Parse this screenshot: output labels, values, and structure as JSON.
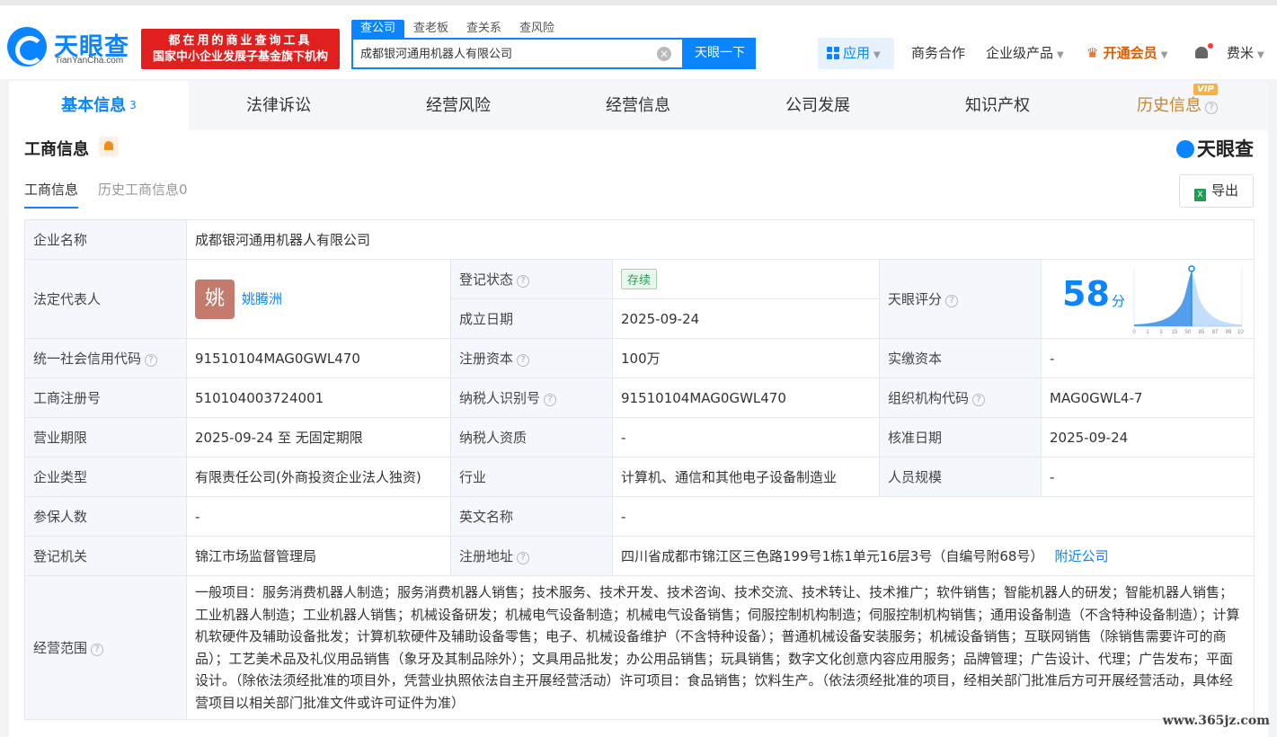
{
  "header": {
    "logo_text": "天眼查",
    "logo_domain": "TianYanCha.com",
    "promo_line1": "都在用的商业查询工具",
    "promo_line2": "国家中小企业发展子基金旗下机构",
    "search_tabs": [
      "查公司",
      "查老板",
      "查关系",
      "查风险"
    ],
    "search_value": "成都银河通用机器人有限公司",
    "search_button": "天眼一下",
    "nav": {
      "app": "应用",
      "business": "商务合作",
      "enterprise": "企业级产品",
      "vip": "开通会员",
      "user": "费米"
    }
  },
  "tabs": {
    "basic": "基本信息",
    "basic_count": "3",
    "legal": "法律诉讼",
    "risk": "经营风险",
    "operation": "经营信息",
    "development": "公司发展",
    "ip": "知识产权",
    "history": "历史信息",
    "vip_badge": "VIP"
  },
  "section": {
    "title": "工商信息",
    "brand": "天眼查",
    "subtab_current": "工商信息",
    "subtab_history": "历史工商信息0",
    "export": "导出"
  },
  "info": {
    "company_name_label": "企业名称",
    "company_name": "成都银河通用机器人有限公司",
    "legal_rep_label": "法定代表人",
    "legal_rep_avatar": "姚",
    "legal_rep": "姚腾洲",
    "reg_status_label": "登记状态",
    "reg_status": "存续",
    "found_date_label": "成立日期",
    "found_date": "2025-09-24",
    "score_label": "天眼评分",
    "score": "58",
    "score_unit": "分",
    "credit_code_label": "统一社会信用代码",
    "credit_code": "91510104MAG0GWL470",
    "reg_capital_label": "注册资本",
    "reg_capital": "100万",
    "paid_capital_label": "实缴资本",
    "paid_capital": "-",
    "reg_no_label": "工商注册号",
    "reg_no": "510104003724001",
    "tax_id_label": "纳税人识别号",
    "tax_id": "91510104MAG0GWL470",
    "org_code_label": "组织机构代码",
    "org_code": "MAG0GWL4-7",
    "term_label": "营业期限",
    "term": "2025-09-24 至 无固定期限",
    "tax_qual_label": "纳税人资质",
    "tax_qual": "-",
    "approve_date_label": "核准日期",
    "approve_date": "2025-09-24",
    "type_label": "企业类型",
    "type": "有限责任公司(外商投资企业法人独资)",
    "industry_label": "行业",
    "industry": "计算机、通信和其他电子设备制造业",
    "staff_label": "人员规模",
    "staff": "-",
    "insured_label": "参保人数",
    "insured": "-",
    "en_name_label": "英文名称",
    "en_name": "-",
    "authority_label": "登记机关",
    "authority": "锦江市场监督管理局",
    "address_label": "注册地址",
    "address": "四川省成都市锦江区三色路199号1栋1单元16层3号（自编号附68号）",
    "nearby": "附近公司",
    "scope_label": "经营范围",
    "scope": "一般项目：服务消费机器人制造；服务消费机器人销售；技术服务、技术开发、技术咨询、技术交流、技术转让、技术推广；软件销售；智能机器人的研发；智能机器人销售；工业机器人制造；工业机器人销售；机械设备研发；机械电气设备制造；机械电气设备销售；伺服控制机构制造；伺服控制机构销售；通用设备制造（不含特种设备制造）；计算机软硬件及辅助设备批发；计算机软硬件及辅助设备零售；电子、机械设备维护（不含特种设备）；普通机械设备安装服务；机械设备销售；互联网销售（除销售需要许可的商品）；工艺美术品及礼仪用品销售（象牙及其制品除外）；文具用品批发；办公用品销售；玩具销售；数字文化创意内容应用服务；品牌管理；广告设计、代理；广告发布；平面设计。（除依法须经批准的项目外，凭营业执照依法自主开展经营活动）许可项目：食品销售；饮料生产。（依法须经批准的项目，经相关部门批准后方可开展经营活动，具体经营项目以相关部门批准文件或许可证件为准）"
  },
  "score_chart": {
    "ticks": [
      "0",
      "1",
      "3",
      "15",
      "50",
      "85",
      "97",
      "99",
      "100"
    ],
    "marker": 58
  },
  "watermark": "www.365jz.com",
  "colors": {
    "accent": "#0a84ff",
    "promo": "#e0201f",
    "vip": "#c8852b"
  }
}
